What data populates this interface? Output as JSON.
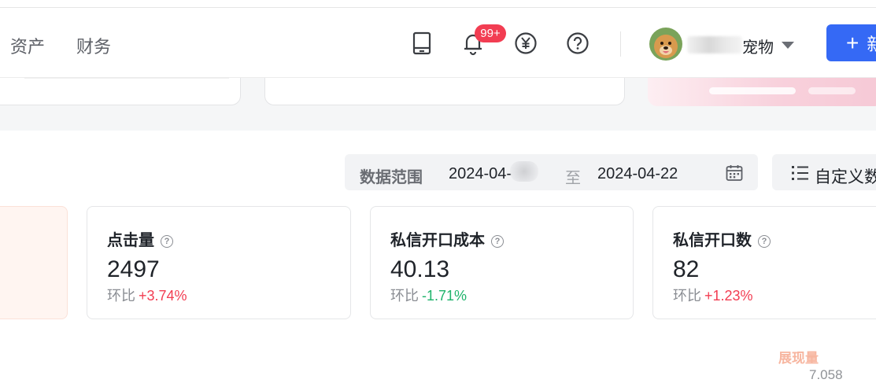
{
  "nav": {
    "items": [
      "资产",
      "财务"
    ],
    "notification_badge": "99+",
    "user_name": "宠物",
    "create_label": "新"
  },
  "filter": {
    "range_label": "数据范围",
    "start_date": "2024-04-",
    "separator": "至",
    "end_date": "2024-04-22",
    "custom_label": "自定义数"
  },
  "metrics": [
    {
      "title": "点击量",
      "value": "2497",
      "compare_label": "环比",
      "change": "+3.74%",
      "trend": "up"
    },
    {
      "title": "私信开口成本",
      "value": "40.13",
      "compare_label": "环比",
      "change": "-1.71%",
      "trend": "down"
    },
    {
      "title": "私信开口数",
      "value": "82",
      "compare_label": "环比",
      "change": "+1.23%",
      "trend": "up"
    }
  ],
  "chart_peek": {
    "label": "展现量",
    "value": "7.058"
  },
  "icons": [
    "tablet-icon",
    "bell-icon",
    "yuan-icon",
    "help-icon",
    "calendar-icon",
    "list-settings-icon"
  ],
  "colors": {
    "accent": "#3569f5",
    "badge": "#f23d52",
    "up": "#f23d52",
    "down": "#1fb36b"
  }
}
